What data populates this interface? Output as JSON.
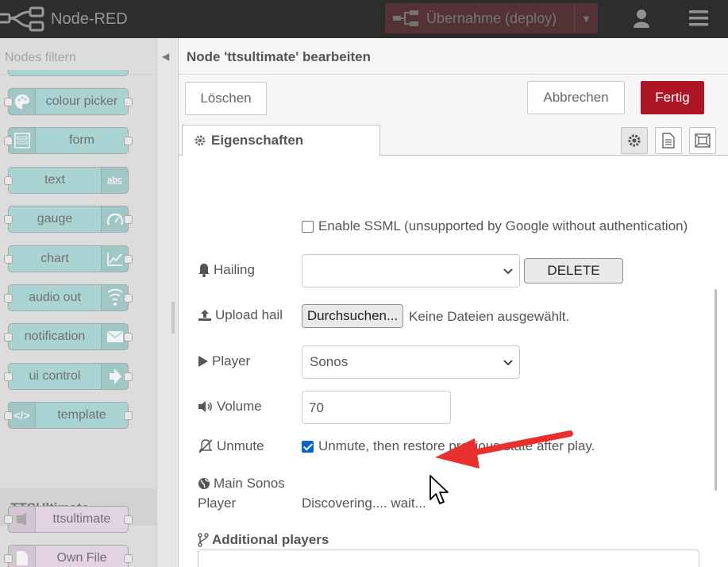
{
  "header": {
    "app_name": "Node-RED",
    "deploy_label": "Übernahme (deploy)",
    "icons": [
      "node-red-logo",
      "deploy-icon",
      "chevron-down-icon",
      "user-icon",
      "menu-icon"
    ]
  },
  "palette": {
    "filter_placeholder": "Nodes filtern",
    "nodes": [
      {
        "label": "colour picker",
        "icon": "palette-icon"
      },
      {
        "label": "form",
        "icon": "form-icon"
      },
      {
        "label": "text",
        "icon": "abc-icon"
      },
      {
        "label": "gauge",
        "icon": "gauge-icon"
      },
      {
        "label": "chart",
        "icon": "chart-icon"
      },
      {
        "label": "audio out",
        "icon": "audio-icon"
      },
      {
        "label": "notification",
        "icon": "envelope-icon"
      },
      {
        "label": "ui control",
        "icon": "arrow-right-icon"
      },
      {
        "label": "template",
        "icon": "code-icon"
      }
    ],
    "section_title": "TTSUltimate",
    "section_nodes": [
      {
        "label": "ttsultimate",
        "icon": "speaker-icon"
      },
      {
        "label": "Own File",
        "icon": "file-icon"
      }
    ]
  },
  "editor": {
    "title": "Node 'ttsultimate' bearbeiten",
    "delete_label": "Löschen",
    "cancel_label": "Abbrechen",
    "done_label": "Fertig",
    "tab_label": "Eigenschaften",
    "tab_icons": [
      "gear-icon",
      "document-icon",
      "frame-icon"
    ],
    "ssml_label": "Enable SSML (unsupported by Google without authentication)",
    "ssml_checked": false,
    "hailing_label": "Hailing",
    "hailing_value": "",
    "hailing_delete": "DELETE",
    "upload_label": "Upload hail",
    "browse_label": "Durchsuchen...",
    "no_file_label": "Keine Dateien ausgewählt.",
    "player_label": "Player",
    "player_value": "Sonos",
    "volume_label": "Volume",
    "volume_value": "70",
    "unmute_label": "Unmute",
    "unmute_checkbox_label": "Unmute, then restore previous state after play.",
    "unmute_checked": true,
    "main_player_label_1": "Main Sonos",
    "main_player_label_2": "Player",
    "discovering_text": "Discovering.... wait...",
    "additional_players_label": "Additional players"
  },
  "colors": {
    "header_bg": "#000000",
    "deploy_bg": "#8c101c",
    "primary_button": "#ad1625",
    "node_teal": "#a9d4d3",
    "node_pink": "#e2d2e2",
    "annotation_arrow": "#e8312f"
  }
}
